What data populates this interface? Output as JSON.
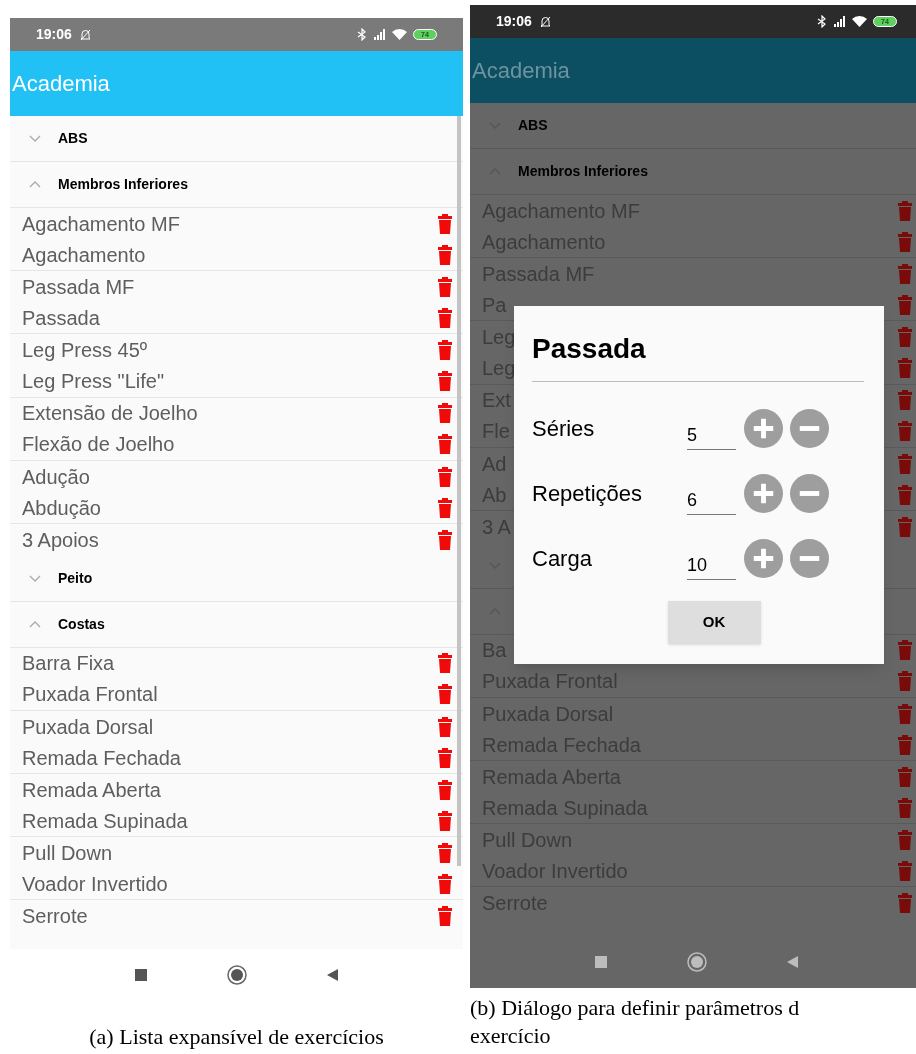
{
  "figures": [
    {
      "dimmed": false,
      "caption_lines": [
        "(a) Lista expansível de exercícios"
      ],
      "status_bar": {
        "time": "19:06",
        "battery": "74"
      },
      "app_bar": {
        "title": "Academia"
      },
      "groups": [
        {
          "title": "ABS",
          "expanded": false
        },
        {
          "title": "Membros Inferiores",
          "expanded": true,
          "items": [
            "Agachamento MF",
            "Agachamento",
            "Passada MF",
            "Passada",
            "Leg Press 45º",
            "Leg Press \"Life\"",
            "Extensão de Joelho",
            "Flexão de Joelho",
            "Adução",
            "Abdução",
            "3 Apoios"
          ]
        },
        {
          "title": "Peito",
          "expanded": false
        },
        {
          "title": "Costas",
          "expanded": true,
          "items": [
            "Barra Fixa",
            "Puxada Frontal",
            "Puxada Dorsal",
            "Remada Fechada",
            "Remada Aberta",
            "Remada Supinada",
            "Pull Down",
            "Voador Invertido",
            "Serrote"
          ]
        }
      ]
    },
    {
      "dimmed": true,
      "caption_lines": [
        "(b) Diálogo para definir parâmetros d",
        "exercício"
      ],
      "status_bar": {
        "time": "19:06",
        "battery": "74"
      },
      "app_bar": {
        "title": "Academia"
      },
      "groups": [
        {
          "title": "ABS",
          "expanded": false
        },
        {
          "title": "Membros Inferiores",
          "expanded": true,
          "items": [
            "Agachamento MF",
            "Agachamento",
            "Passada MF",
            "Pa",
            "Leg",
            "Leg",
            "Ext",
            "Fle",
            "Ad",
            "Ab",
            "3 A"
          ]
        },
        {
          "expanded": false
        },
        {
          "expanded": true,
          "items": [
            "Ba",
            "Puxada Frontal",
            "Puxada Dorsal",
            "Remada Fechada",
            "Remada Aberta",
            "Remada Supinada",
            "Pull Down",
            "Voador Invertido",
            "Serrote"
          ]
        }
      ],
      "dialog": {
        "title": "Passada",
        "fields": [
          {
            "label": "Séries",
            "value": "5"
          },
          {
            "label": "Repetições",
            "value": "6"
          },
          {
            "label": "Carga",
            "value": "10"
          }
        ],
        "button": "OK"
      }
    }
  ]
}
